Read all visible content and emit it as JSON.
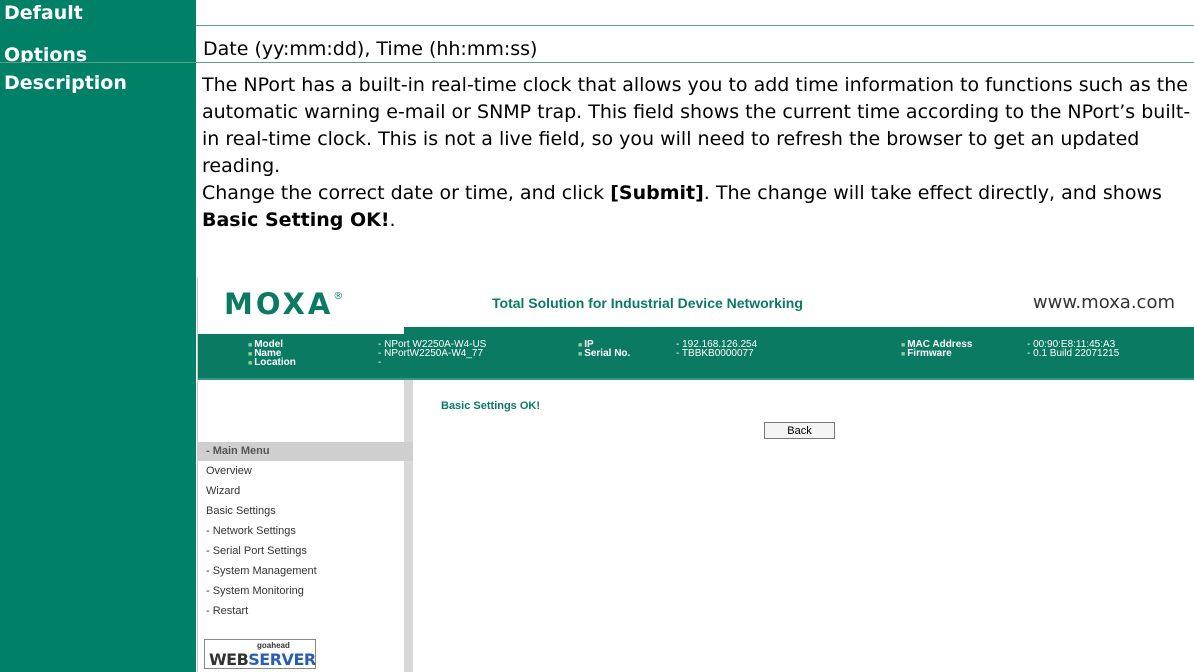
{
  "table": {
    "default_label": "Default",
    "default_value": "",
    "options_label": "Options",
    "options_value": "Date (yy:mm:dd), Time (hh:mm:ss)",
    "description_label": "Description",
    "description_p1": "The NPort has a built-in real-time clock that allows you to add time information to functions such as the automatic warning e-mail or SNMP trap. This field shows the current time according to the NPort’s built-in real-time clock. This is not a live field, so you will need to refresh the browser to get an updated reading.",
    "description_p2_pre": "Change the correct date or time, and click ",
    "description_p2_submit": "[Submit]",
    "description_p2_mid": ". The change will take effect directly, and shows ",
    "description_p2_ok": "Basic Setting OK!",
    "description_p2_end": "."
  },
  "screenshot": {
    "logo": "MOXA",
    "logo_mark": "®",
    "tagline": "Total Solution for Industrial Device Networking",
    "site": "www.moxa.com",
    "info": {
      "model_key": "Model",
      "model_val": "- NPort W2250A-W4-US",
      "name_key": "Name",
      "name_val": "- NPortW2250A-W4_77",
      "location_key": "Location",
      "location_val": "-",
      "ip_key": "IP",
      "ip_val": "- 192.168.126.254",
      "serial_key": "Serial No.",
      "serial_val": "- TBBKB0000077",
      "mac_key": "MAC Address",
      "mac_val": "- 00:90:E8:11:45:A3",
      "firmware_key": "Firmware",
      "firmware_val": "- 0.1 Build 22071215"
    },
    "menu": {
      "head": "- Main Menu",
      "items": [
        "Overview",
        "Wizard",
        "Basic Settings",
        "- Network Settings",
        "- Serial Port Settings",
        "- System Management",
        "- System Monitoring",
        "- Restart"
      ]
    },
    "webserver_small": "goahead",
    "webserver_web": "WEB",
    "webserver_server": "SERVER",
    "ok_message": "Basic Settings OK!",
    "back_label": "Back"
  },
  "colors": {
    "label_bg": "#008066",
    "moxa_green": "#0a7a62"
  }
}
